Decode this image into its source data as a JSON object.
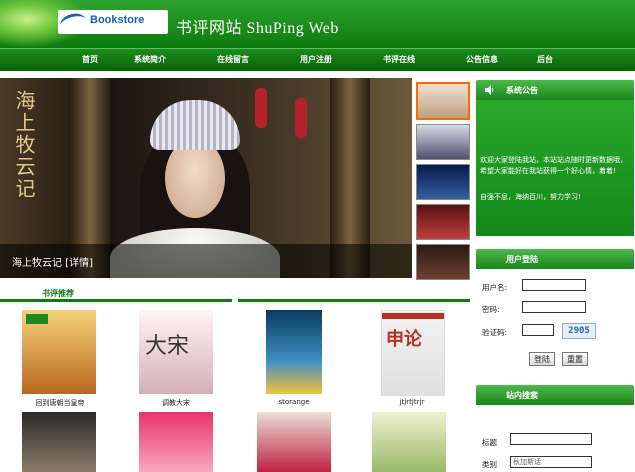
{
  "header": {
    "logo_text": "Bookstore",
    "title": "书评网站 ShuPing Web"
  },
  "nav": [
    "首页",
    "系统简介",
    "在线留言",
    "用户注册",
    "书评在线",
    "公告信息",
    "后台"
  ],
  "banner": {
    "calligraphy": "海上牧云记",
    "caption": "海上牧云记 [详情]"
  },
  "notice": {
    "title": "系统公告",
    "line1": "欢迎大家登陆我站，本站站点随时更新数据哦，希望大家能好在我站获得一个好心情，着着!",
    "line2": "自强不息，海纳百川，努力学习!"
  },
  "login": {
    "title": "用户登陆",
    "username_label": "用户名:",
    "password_label": "密码:",
    "captcha_label": "验证码:",
    "captcha_value": "2905",
    "login_button": "登陆",
    "reset_button": "重置"
  },
  "search": {
    "title": "站内搜索",
    "title_label": "标题",
    "category_label": "类别",
    "category_value": "秋加斯话"
  },
  "recommend": {
    "title": "书评推荐",
    "books": [
      {
        "label": "回到唐朝当皇帝",
        "color": "#c79a3a"
      },
      {
        "label": "调教大宋",
        "color": "#d9b8b8"
      },
      {
        "label": "storange",
        "color": "#1f6ab0"
      },
      {
        "label": "jtjrtjtrjr",
        "color": "#b83020"
      }
    ]
  },
  "colors": {
    "brand_green": "#137a13",
    "header_green": "#1c8c1c",
    "accent_orange": "#ff6a00"
  }
}
